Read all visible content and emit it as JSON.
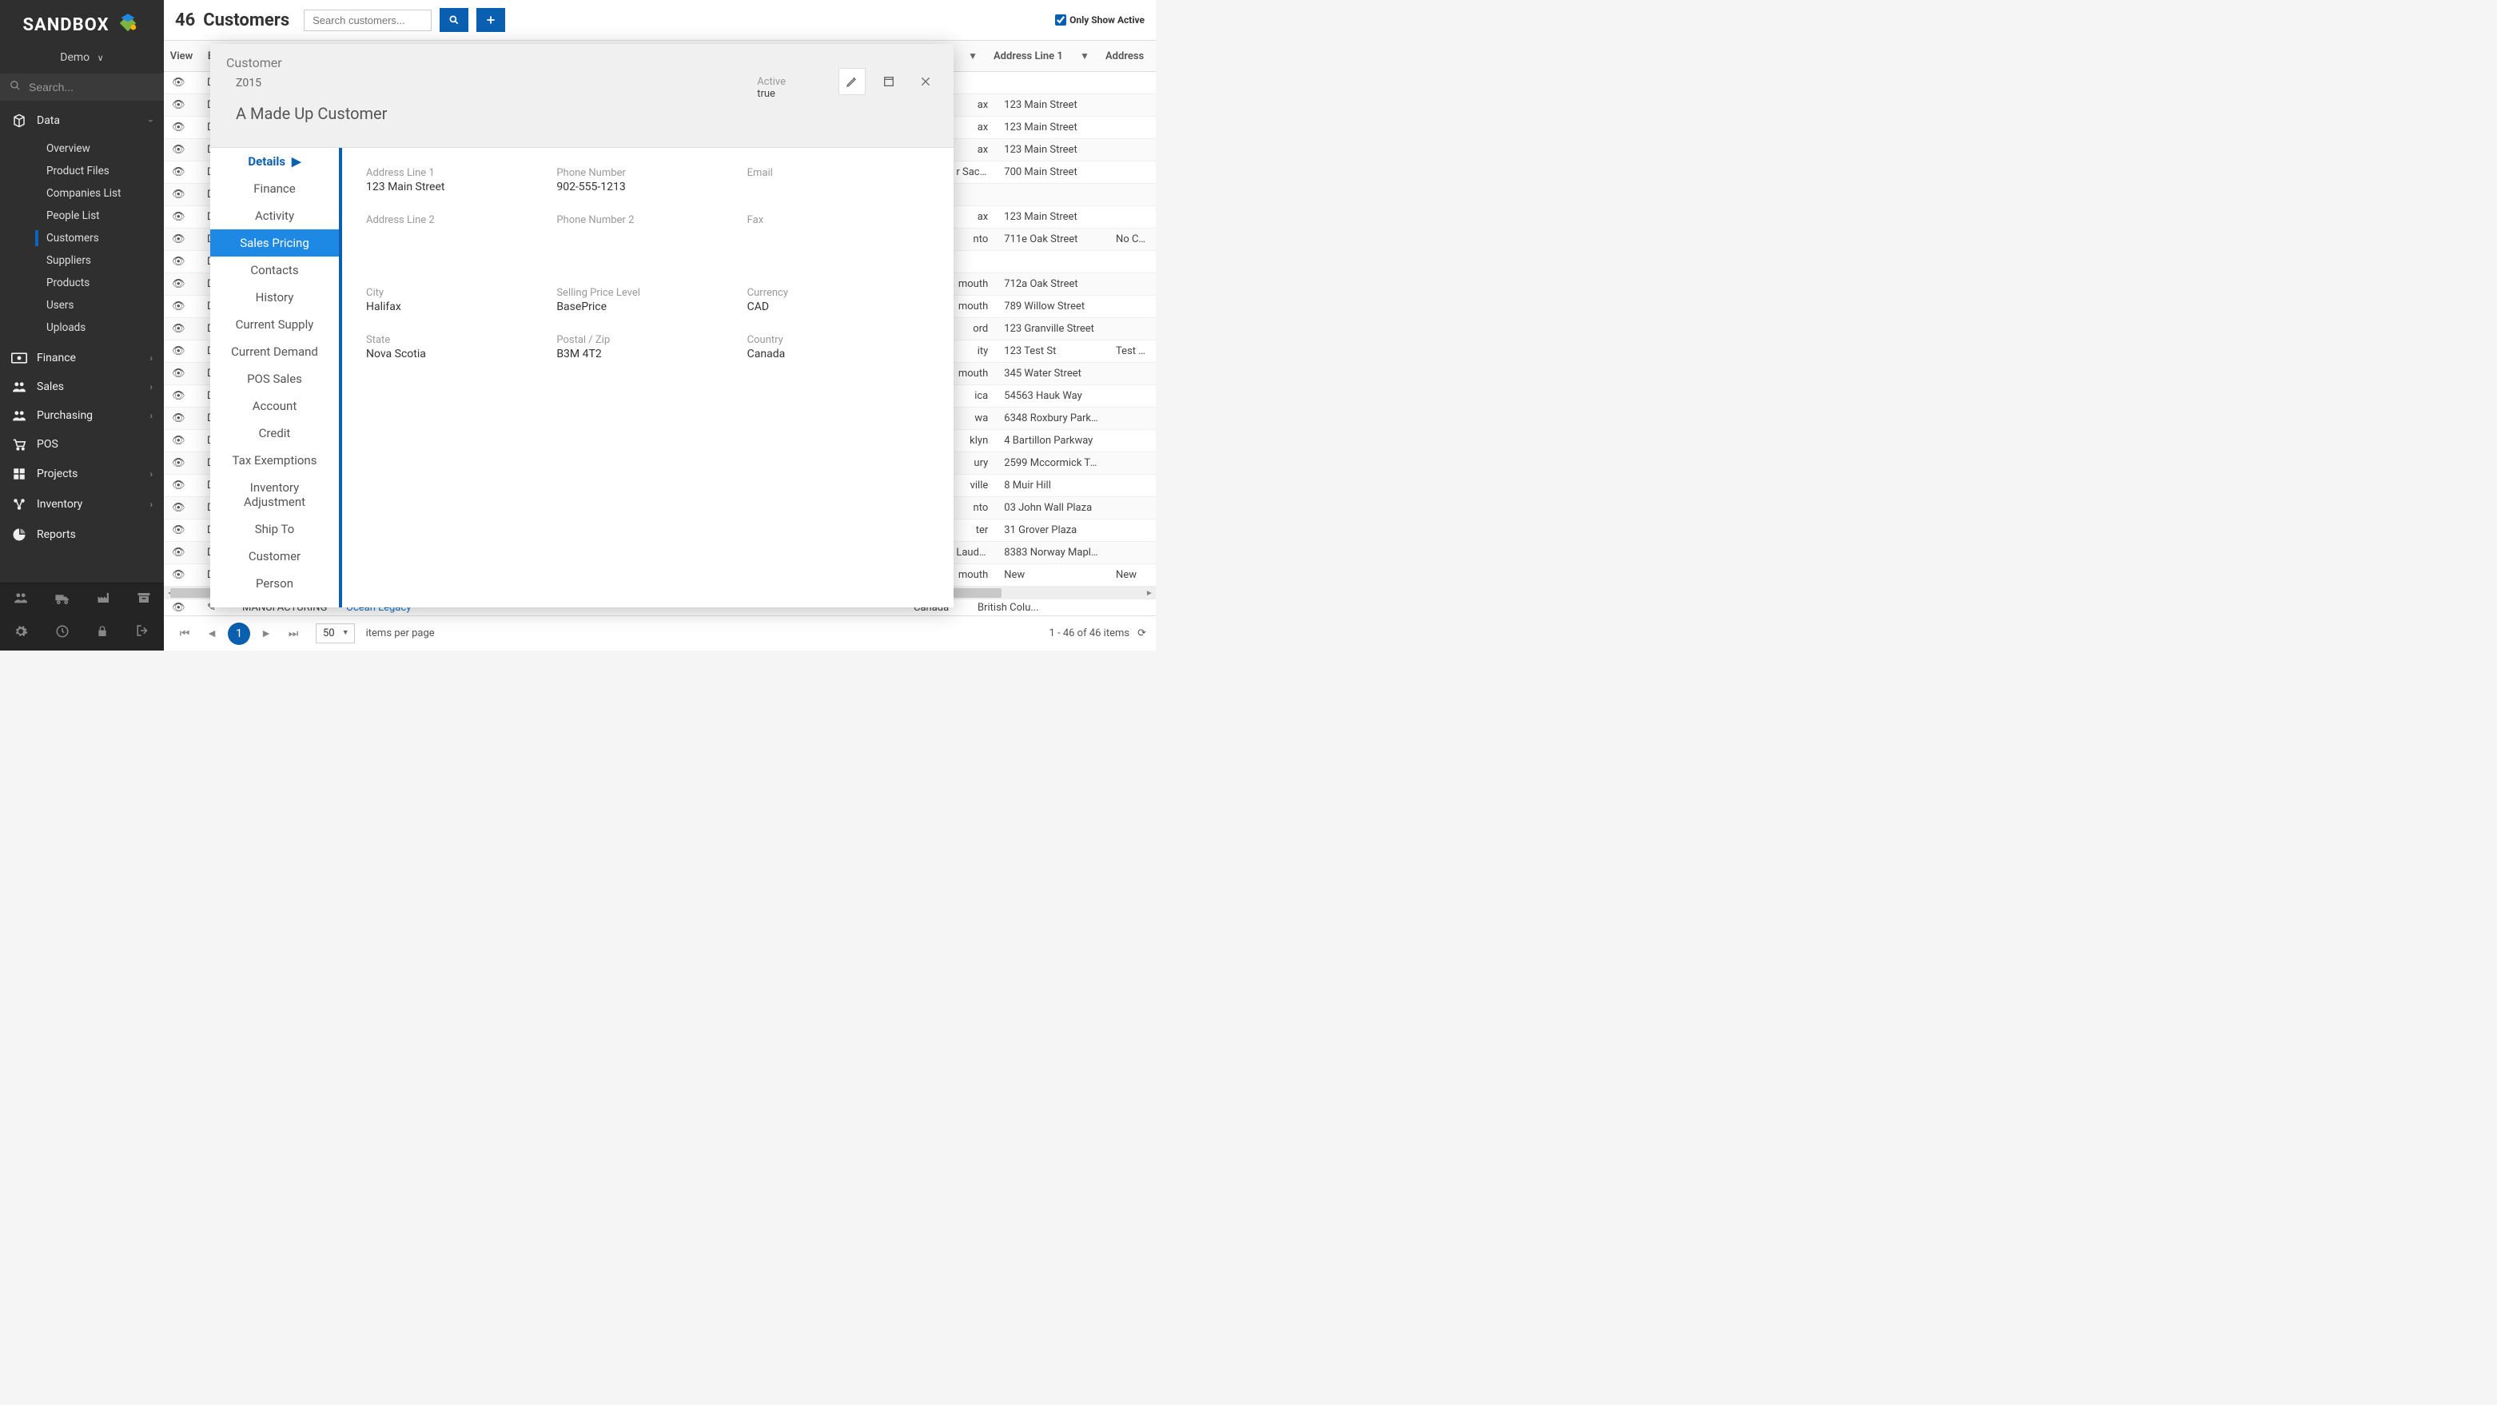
{
  "app": {
    "name": "SANDBOX",
    "tenant": "Demo"
  },
  "sidebar": {
    "search_placeholder": "Search...",
    "groups": [
      {
        "icon": "cube",
        "label": "Data",
        "expanded": true,
        "sub": [
          {
            "label": "Overview"
          },
          {
            "label": "Product Files"
          },
          {
            "label": "Companies List"
          },
          {
            "label": "People List"
          },
          {
            "label": "Customers",
            "active": true
          },
          {
            "label": "Suppliers"
          },
          {
            "label": "Products"
          },
          {
            "label": "Users"
          },
          {
            "label": "Uploads"
          }
        ]
      },
      {
        "icon": "money",
        "label": "Finance"
      },
      {
        "icon": "users",
        "label": "Sales"
      },
      {
        "icon": "users",
        "label": "Purchasing"
      },
      {
        "icon": "cart",
        "label": "POS"
      },
      {
        "icon": "grid",
        "label": "Projects"
      },
      {
        "icon": "flow",
        "label": "Inventory"
      },
      {
        "icon": "pie",
        "label": "Reports"
      }
    ],
    "bottom_row1": [
      "users",
      "truck",
      "factory",
      "archive"
    ],
    "bottom_row2": [
      "gear",
      "clock",
      "lock",
      "logout"
    ]
  },
  "header": {
    "count": "46",
    "title": "Customers",
    "search_placeholder": "Search customers...",
    "only_active_label": "Only Show Active",
    "only_active_checked": true
  },
  "grid": {
    "columns": {
      "view": "View",
      "edit": "Edit",
      "addr1": "Address Line 1",
      "addr2": "Address"
    },
    "rows": [
      {
        "addr1": "",
        "addr2": ""
      },
      {
        "city_frag": "ax",
        "addr1": "123 Main Street",
        "addr2": ""
      },
      {
        "city_frag": "ax",
        "addr1": "123 Main Street",
        "addr2": ""
      },
      {
        "city_frag": "ax",
        "addr1": "123 Main Street",
        "addr2": ""
      },
      {
        "city_frag": "r Sackville",
        "addr1": "700 Main Street",
        "addr2": ""
      },
      {
        "addr1": "",
        "addr2": ""
      },
      {
        "city_frag": "ax",
        "addr1": "123 Main Street",
        "addr2": ""
      },
      {
        "city_frag": "nto",
        "addr1": "711e Oak Street",
        "addr2": "No Cust"
      },
      {
        "addr1": "",
        "addr2": ""
      },
      {
        "city_frag": "mouth",
        "addr1": "712a Oak Street",
        "addr2": ""
      },
      {
        "city_frag": "mouth",
        "addr1": "789 Willow Street",
        "addr2": ""
      },
      {
        "city_frag": "ord",
        "addr1": "123 Granville Street",
        "addr2": ""
      },
      {
        "city_frag": "ity",
        "addr1": "123 Test St",
        "addr2": "Test Co"
      },
      {
        "city_frag": "mouth",
        "addr1": "345 Water Street",
        "addr2": ""
      },
      {
        "city_frag": "ica",
        "addr1": "54563 Hauk Way",
        "addr2": ""
      },
      {
        "city_frag": "wa",
        "addr1": "6348 Roxbury Parkway",
        "addr2": ""
      },
      {
        "city_frag": "klyn",
        "addr1": "4 Bartillon Parkway",
        "addr2": ""
      },
      {
        "city_frag": "ury",
        "addr1": "2599 Mccormick Trail",
        "addr2": ""
      },
      {
        "city_frag": "ville",
        "addr1": "8 Muir Hill",
        "addr2": ""
      },
      {
        "city_frag": "nto",
        "addr1": "03 John Wall Plaza",
        "addr2": ""
      },
      {
        "city_frag": "ter",
        "addr1": "31 Grover Plaza",
        "addr2": ""
      },
      {
        "city_frag": "Lauderdale",
        "addr1": "8383 Norway Maple La...",
        "addr2": ""
      },
      {
        "city_frag": "mouth",
        "addr1": "New",
        "addr2": "New"
      }
    ],
    "visible_row_extra": {
      "col_a": "MANUFACTURING",
      "col_b": "Ocean Legacy",
      "col_c": "Canada",
      "col_d": "British Colu..."
    }
  },
  "pager": {
    "page": "1",
    "page_size": "50",
    "per_page_label": "items per page",
    "summary": "1 - 46 of 46 items"
  },
  "panel": {
    "title": "Customer",
    "code": "Z015",
    "name": "A Made Up Customer",
    "status_label": "Active",
    "status_value": "true",
    "tabs": [
      "Details",
      "Finance",
      "Activity",
      "Sales Pricing",
      "Contacts",
      "History",
      "Current Supply",
      "Current Demand",
      "POS Sales",
      "Account",
      "Credit",
      "Tax Exemptions",
      "Inventory Adjustment",
      "Ship To",
      "Customer",
      "Person"
    ],
    "active_tab": "Sales Pricing",
    "detail_fields": {
      "addr1_label": "Address Line 1",
      "addr1_value": "123 Main Street",
      "phone1_label": "Phone Number",
      "phone1_value": "902-555-1213",
      "email_label": "Email",
      "email_value": "",
      "addr2_label": "Address Line 2",
      "addr2_value": "",
      "phone2_label": "Phone Number 2",
      "phone2_value": "",
      "fax_label": "Fax",
      "fax_value": "",
      "city_label": "City",
      "city_value": "Halifax",
      "spl_label": "Selling Price Level",
      "spl_value": "BasePrice",
      "currency_label": "Currency",
      "currency_value": "CAD",
      "state_label": "State",
      "state_value": "Nova Scotia",
      "postal_label": "Postal / Zip",
      "postal_value": "B3M 4T2",
      "country_label": "Country",
      "country_value": "Canada"
    }
  }
}
